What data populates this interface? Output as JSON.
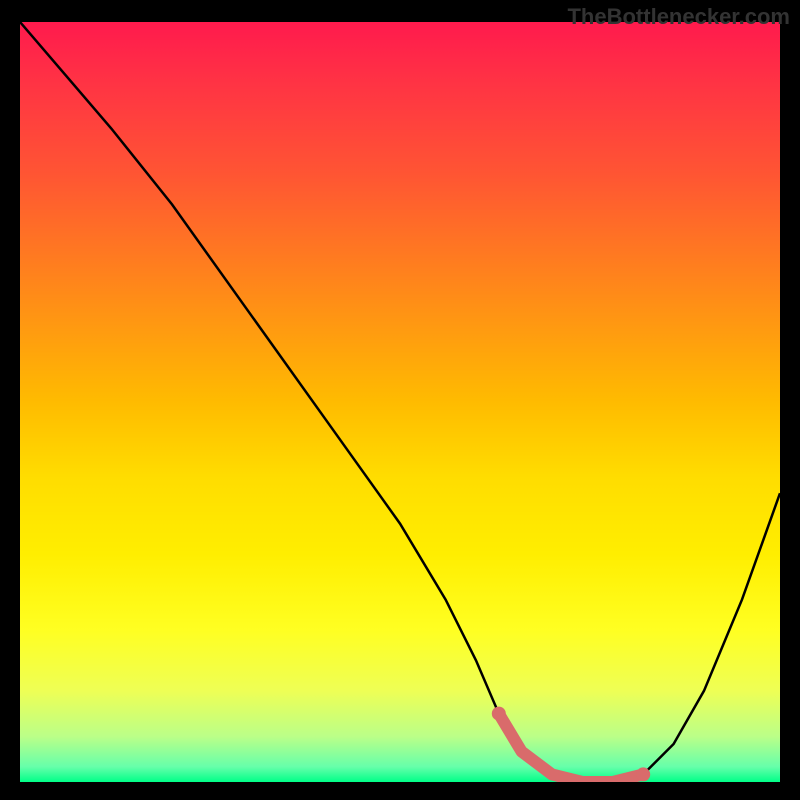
{
  "watermark": "TheBottleneсker.com",
  "chart_data": {
    "type": "line",
    "title": "",
    "xlabel": "",
    "ylabel": "",
    "xlim": [
      0,
      100
    ],
    "ylim": [
      0,
      100
    ],
    "series": [
      {
        "name": "bottleneck-curve",
        "color": "#000000",
        "x": [
          0,
          6,
          12,
          20,
          30,
          40,
          50,
          56,
          60,
          63,
          66,
          70,
          74,
          78,
          82,
          86,
          90,
          95,
          100
        ],
        "y": [
          100,
          93,
          86,
          76,
          62,
          48,
          34,
          24,
          16,
          9,
          4,
          1,
          0,
          0,
          1,
          5,
          12,
          24,
          38
        ]
      }
    ],
    "annotations": [
      {
        "name": "optimal-zone",
        "type": "highlight-segment",
        "color": "#d96b6b",
        "x_range": [
          63,
          82
        ]
      }
    ],
    "gradient_background": {
      "direction": "top-to-bottom",
      "stops": [
        {
          "pos": 0.0,
          "color": "#ff1a4d"
        },
        {
          "pos": 0.5,
          "color": "#ffdd00"
        },
        {
          "pos": 0.95,
          "color": "#bbff88"
        },
        {
          "pos": 1.0,
          "color": "#00ff88"
        }
      ]
    }
  }
}
